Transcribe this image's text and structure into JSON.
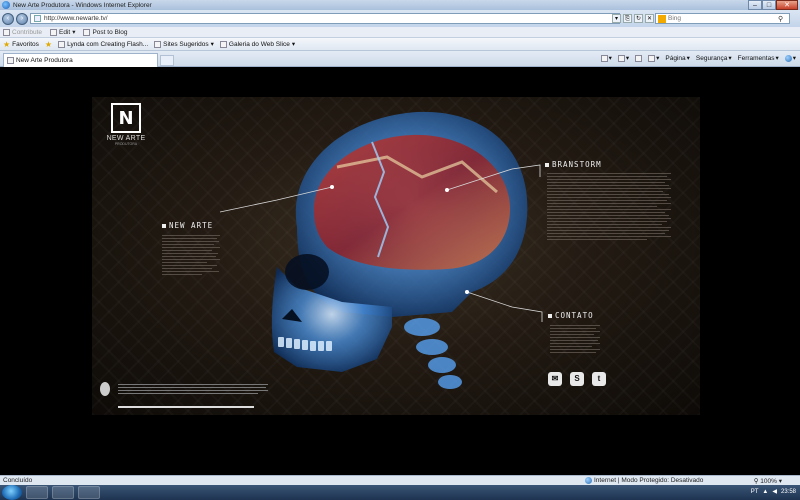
{
  "window": {
    "title": "New Arte Produtora - Windows Internet Explorer",
    "minimize": "–",
    "maximize": "□",
    "close": "✕"
  },
  "address": {
    "url": "http://www.newarte.tv/",
    "search_placeholder": "Bing"
  },
  "command_bar": {
    "contribute": "Contribute",
    "edit": "Edit",
    "post_to_blog": "Post to Blog"
  },
  "favorites_bar": {
    "favorites": "Favoritos",
    "items": [
      "Lynda com Creating Flash...",
      "Sites Sugeridos",
      "Galeria do Web Slice"
    ]
  },
  "tab": {
    "label": "New Arte Produtora"
  },
  "toolbar": {
    "page": "Página",
    "security": "Segurança",
    "tools": "Ferramentas"
  },
  "page": {
    "logo_name": "NEW ARTE",
    "logo_sub": "PRODUTORA",
    "labels": {
      "new_arte": "NEW ARTE",
      "brainstorm": "BRANSTORM",
      "contato": "CONTATO"
    }
  },
  "status": {
    "text": "Concluído",
    "zone": "Internet | Modo Protegido: Desativado",
    "zoom": "100%"
  },
  "taskbar": {
    "language": "PT",
    "clock": "23:58"
  },
  "colors": {
    "accent_line": "#d8d8d8",
    "skull_blue": "#5aa9ff",
    "brain_red": "#b3262a"
  }
}
